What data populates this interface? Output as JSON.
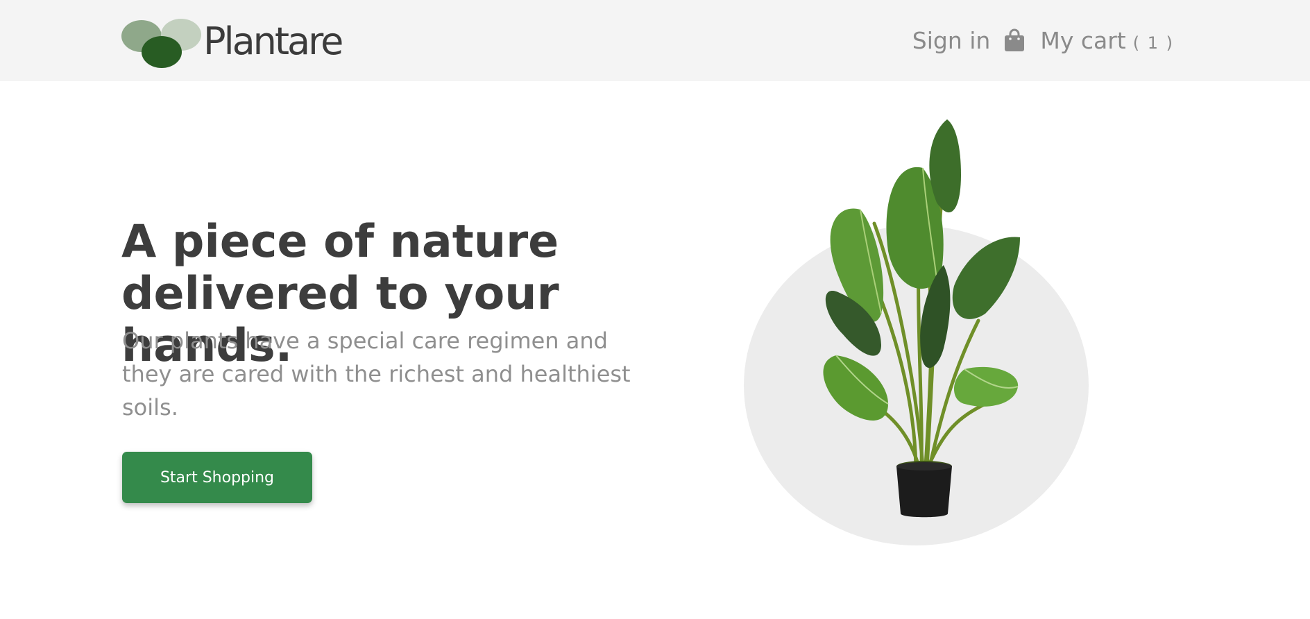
{
  "brand": {
    "name": "Plantare",
    "logo_icon": "leaf-ovals-logo",
    "colors": [
      "#8fa88a",
      "#c3d0bf",
      "#285c23"
    ]
  },
  "nav": {
    "sign_in": "Sign in",
    "cart_icon": "shopping-bag-icon",
    "cart_label": "My cart",
    "cart_count": "( 1 )"
  },
  "hero": {
    "headline": "A piece of nature delivered to your hands.",
    "subtext": "Our plants have a special care regimen and they are cared with the richest and healthiest soils.",
    "cta": "Start Shopping",
    "image": "potted-plant-image"
  },
  "colors": {
    "accent": "#348a4b",
    "header_bg": "#f4f4f4",
    "text_dark": "#3d3d3d",
    "text_muted": "#8f8f8f",
    "circle": "#ececec"
  }
}
